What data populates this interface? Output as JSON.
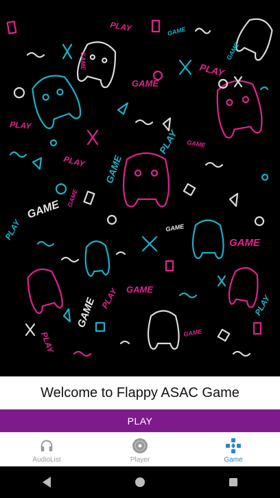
{
  "welcome_text": "Welcome to Flappy ASAC Game",
  "play_button_label": "PLAY",
  "bottom_nav": [
    {
      "label": "AudioList",
      "icon": "headphones-icon",
      "active": false
    },
    {
      "label": "Player",
      "icon": "disc-icon",
      "active": false
    },
    {
      "label": "Game",
      "icon": "gamepad-icon",
      "active": true
    }
  ],
  "background_words": {
    "play": "PLAY",
    "game": "GAME"
  },
  "colors": {
    "accent": "#7e1a8c",
    "active_nav": "#2f83d8",
    "neon_pink": "#e0238f",
    "neon_cyan": "#19b3c9",
    "neon_white": "#e8e8e8"
  },
  "system_nav": [
    "back-icon",
    "home-icon",
    "recents-icon"
  ]
}
